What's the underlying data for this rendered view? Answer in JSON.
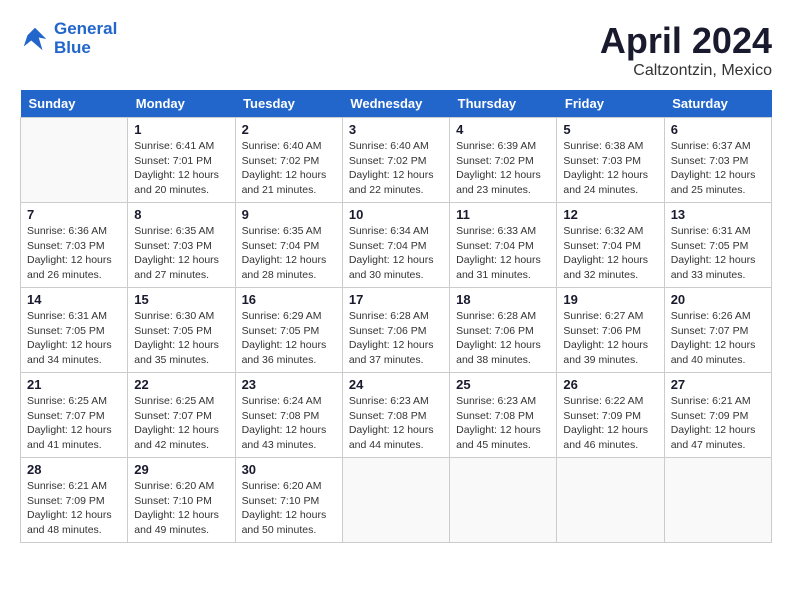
{
  "header": {
    "logo_line1": "General",
    "logo_line2": "Blue",
    "month": "April 2024",
    "location": "Caltzontzin, Mexico"
  },
  "weekdays": [
    "Sunday",
    "Monday",
    "Tuesday",
    "Wednesday",
    "Thursday",
    "Friday",
    "Saturday"
  ],
  "weeks": [
    [
      {
        "day": "",
        "info": ""
      },
      {
        "day": "1",
        "info": "Sunrise: 6:41 AM\nSunset: 7:01 PM\nDaylight: 12 hours\nand 20 minutes."
      },
      {
        "day": "2",
        "info": "Sunrise: 6:40 AM\nSunset: 7:02 PM\nDaylight: 12 hours\nand 21 minutes."
      },
      {
        "day": "3",
        "info": "Sunrise: 6:40 AM\nSunset: 7:02 PM\nDaylight: 12 hours\nand 22 minutes."
      },
      {
        "day": "4",
        "info": "Sunrise: 6:39 AM\nSunset: 7:02 PM\nDaylight: 12 hours\nand 23 minutes."
      },
      {
        "day": "5",
        "info": "Sunrise: 6:38 AM\nSunset: 7:03 PM\nDaylight: 12 hours\nand 24 minutes."
      },
      {
        "day": "6",
        "info": "Sunrise: 6:37 AM\nSunset: 7:03 PM\nDaylight: 12 hours\nand 25 minutes."
      }
    ],
    [
      {
        "day": "7",
        "info": "Sunrise: 6:36 AM\nSunset: 7:03 PM\nDaylight: 12 hours\nand 26 minutes."
      },
      {
        "day": "8",
        "info": "Sunrise: 6:35 AM\nSunset: 7:03 PM\nDaylight: 12 hours\nand 27 minutes."
      },
      {
        "day": "9",
        "info": "Sunrise: 6:35 AM\nSunset: 7:04 PM\nDaylight: 12 hours\nand 28 minutes."
      },
      {
        "day": "10",
        "info": "Sunrise: 6:34 AM\nSunset: 7:04 PM\nDaylight: 12 hours\nand 30 minutes."
      },
      {
        "day": "11",
        "info": "Sunrise: 6:33 AM\nSunset: 7:04 PM\nDaylight: 12 hours\nand 31 minutes."
      },
      {
        "day": "12",
        "info": "Sunrise: 6:32 AM\nSunset: 7:04 PM\nDaylight: 12 hours\nand 32 minutes."
      },
      {
        "day": "13",
        "info": "Sunrise: 6:31 AM\nSunset: 7:05 PM\nDaylight: 12 hours\nand 33 minutes."
      }
    ],
    [
      {
        "day": "14",
        "info": "Sunrise: 6:31 AM\nSunset: 7:05 PM\nDaylight: 12 hours\nand 34 minutes."
      },
      {
        "day": "15",
        "info": "Sunrise: 6:30 AM\nSunset: 7:05 PM\nDaylight: 12 hours\nand 35 minutes."
      },
      {
        "day": "16",
        "info": "Sunrise: 6:29 AM\nSunset: 7:05 PM\nDaylight: 12 hours\nand 36 minutes."
      },
      {
        "day": "17",
        "info": "Sunrise: 6:28 AM\nSunset: 7:06 PM\nDaylight: 12 hours\nand 37 minutes."
      },
      {
        "day": "18",
        "info": "Sunrise: 6:28 AM\nSunset: 7:06 PM\nDaylight: 12 hours\nand 38 minutes."
      },
      {
        "day": "19",
        "info": "Sunrise: 6:27 AM\nSunset: 7:06 PM\nDaylight: 12 hours\nand 39 minutes."
      },
      {
        "day": "20",
        "info": "Sunrise: 6:26 AM\nSunset: 7:07 PM\nDaylight: 12 hours\nand 40 minutes."
      }
    ],
    [
      {
        "day": "21",
        "info": "Sunrise: 6:25 AM\nSunset: 7:07 PM\nDaylight: 12 hours\nand 41 minutes."
      },
      {
        "day": "22",
        "info": "Sunrise: 6:25 AM\nSunset: 7:07 PM\nDaylight: 12 hours\nand 42 minutes."
      },
      {
        "day": "23",
        "info": "Sunrise: 6:24 AM\nSunset: 7:08 PM\nDaylight: 12 hours\nand 43 minutes."
      },
      {
        "day": "24",
        "info": "Sunrise: 6:23 AM\nSunset: 7:08 PM\nDaylight: 12 hours\nand 44 minutes."
      },
      {
        "day": "25",
        "info": "Sunrise: 6:23 AM\nSunset: 7:08 PM\nDaylight: 12 hours\nand 45 minutes."
      },
      {
        "day": "26",
        "info": "Sunrise: 6:22 AM\nSunset: 7:09 PM\nDaylight: 12 hours\nand 46 minutes."
      },
      {
        "day": "27",
        "info": "Sunrise: 6:21 AM\nSunset: 7:09 PM\nDaylight: 12 hours\nand 47 minutes."
      }
    ],
    [
      {
        "day": "28",
        "info": "Sunrise: 6:21 AM\nSunset: 7:09 PM\nDaylight: 12 hours\nand 48 minutes."
      },
      {
        "day": "29",
        "info": "Sunrise: 6:20 AM\nSunset: 7:10 PM\nDaylight: 12 hours\nand 49 minutes."
      },
      {
        "day": "30",
        "info": "Sunrise: 6:20 AM\nSunset: 7:10 PM\nDaylight: 12 hours\nand 50 minutes."
      },
      {
        "day": "",
        "info": ""
      },
      {
        "day": "",
        "info": ""
      },
      {
        "day": "",
        "info": ""
      },
      {
        "day": "",
        "info": ""
      }
    ]
  ]
}
